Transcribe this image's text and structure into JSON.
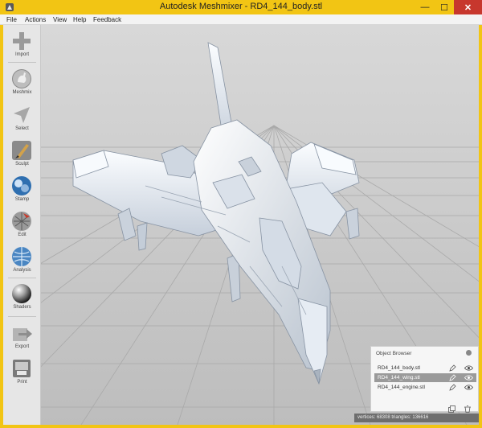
{
  "window": {
    "title": "Autodesk Meshmixer - RD4_144_body.stl",
    "minimize_glyph": "—",
    "maximize_glyph": "☐",
    "close_glyph": "✕"
  },
  "menubar": {
    "items": [
      "File",
      "Actions",
      "View",
      "Help",
      "Feedback"
    ]
  },
  "toolbar": {
    "tools": [
      {
        "label": "Import",
        "icon": "plus-icon"
      },
      {
        "label": "Meshmix",
        "icon": "bunny-sphere-icon"
      },
      {
        "label": "Select",
        "icon": "arrow-cursor-icon"
      },
      {
        "label": "Sculpt",
        "icon": "brush-icon"
      },
      {
        "label": "Stamp",
        "icon": "stamp-icon"
      },
      {
        "label": "Edit",
        "icon": "mesh-edit-icon"
      },
      {
        "label": "Analysis",
        "icon": "analysis-sphere-icon"
      },
      {
        "label": "Shaders",
        "icon": "shader-sphere-icon"
      },
      {
        "label": "Export",
        "icon": "export-arrow-icon"
      },
      {
        "label": "Print",
        "icon": "printer-icon"
      }
    ]
  },
  "object_browser": {
    "title": "Object Browser",
    "objects": [
      {
        "name": "RD4_144_body.stl",
        "selected": false
      },
      {
        "name": "RD4_144_wing.stl",
        "selected": true
      },
      {
        "name": "RD4_144_engine.stl",
        "selected": false
      }
    ]
  },
  "status": {
    "text": "vertices: 68308  triangles: 136616"
  },
  "colors": {
    "titlebar": "#f2c514",
    "close": "#c7372d",
    "viewport": "#c8c8c8",
    "model": "#e8eef6"
  }
}
